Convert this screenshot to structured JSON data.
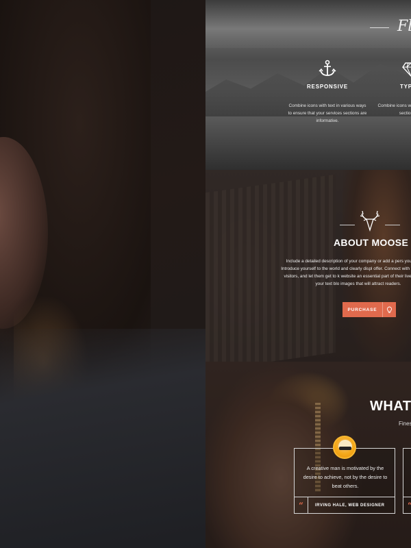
{
  "features": {
    "heading_script": "Fl",
    "items": [
      {
        "title": "RESPONSIVE",
        "icon": "anchor-icon",
        "desc": "Combine icons with text in various ways to ensure that your services sections are informative."
      },
      {
        "title": "TYPOG",
        "icon": "diamond-icon",
        "desc": "Combine icons w ways to ensure t sections are"
      }
    ]
  },
  "about": {
    "icon": "deer-icon",
    "title": "ABOUT MOOSE",
    "text": "Include a detailed description of your company or add a pers your website. Introduce yourself to the world and clearly displ offer. Connect with your website visitors, and let them get to k website an essential part of their lives. Liven up your text blo images that will attract readers.",
    "button_label": "PURCHASE",
    "button_icon": "lightbulb-icon",
    "accent": "#e06a4d"
  },
  "testimonials": {
    "title": "WHAT",
    "subtitle": "Fines",
    "cards": [
      {
        "quote": "A creative man is motivated by the desire to achieve, not by the desire to beat others.",
        "author": "IRVING HALE, WEB DESIGNER"
      },
      {
        "quote": "",
        "author": ""
      }
    ]
  }
}
